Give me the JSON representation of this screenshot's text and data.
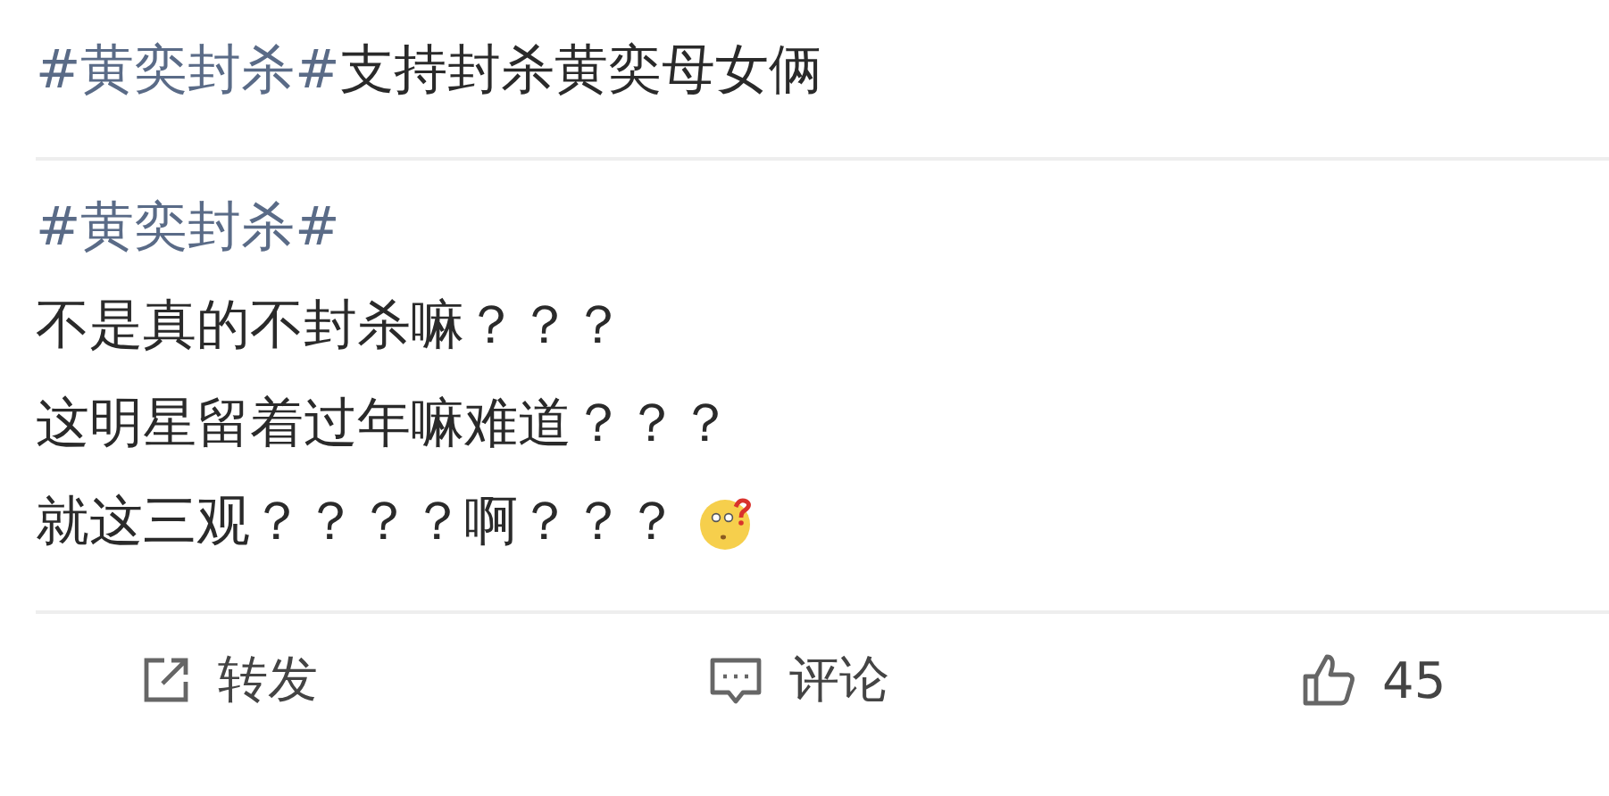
{
  "title": {
    "hashtag": "#黄奕封杀#",
    "text": "支持封杀黄奕母女俩"
  },
  "post": {
    "hashtag": "#黄奕封杀#",
    "lines": [
      {
        "text": "不是真的不封杀嘛？？？",
        "emoji": false
      },
      {
        "text": "这明星留着过年嘛难道？？？",
        "emoji": false
      },
      {
        "text": "就这三观？？？？啊？？？",
        "emoji": true
      }
    ]
  },
  "actions": [
    {
      "kind": "repost",
      "label": "转发"
    },
    {
      "kind": "comment",
      "label": "评论"
    },
    {
      "kind": "like",
      "label": "45"
    }
  ]
}
